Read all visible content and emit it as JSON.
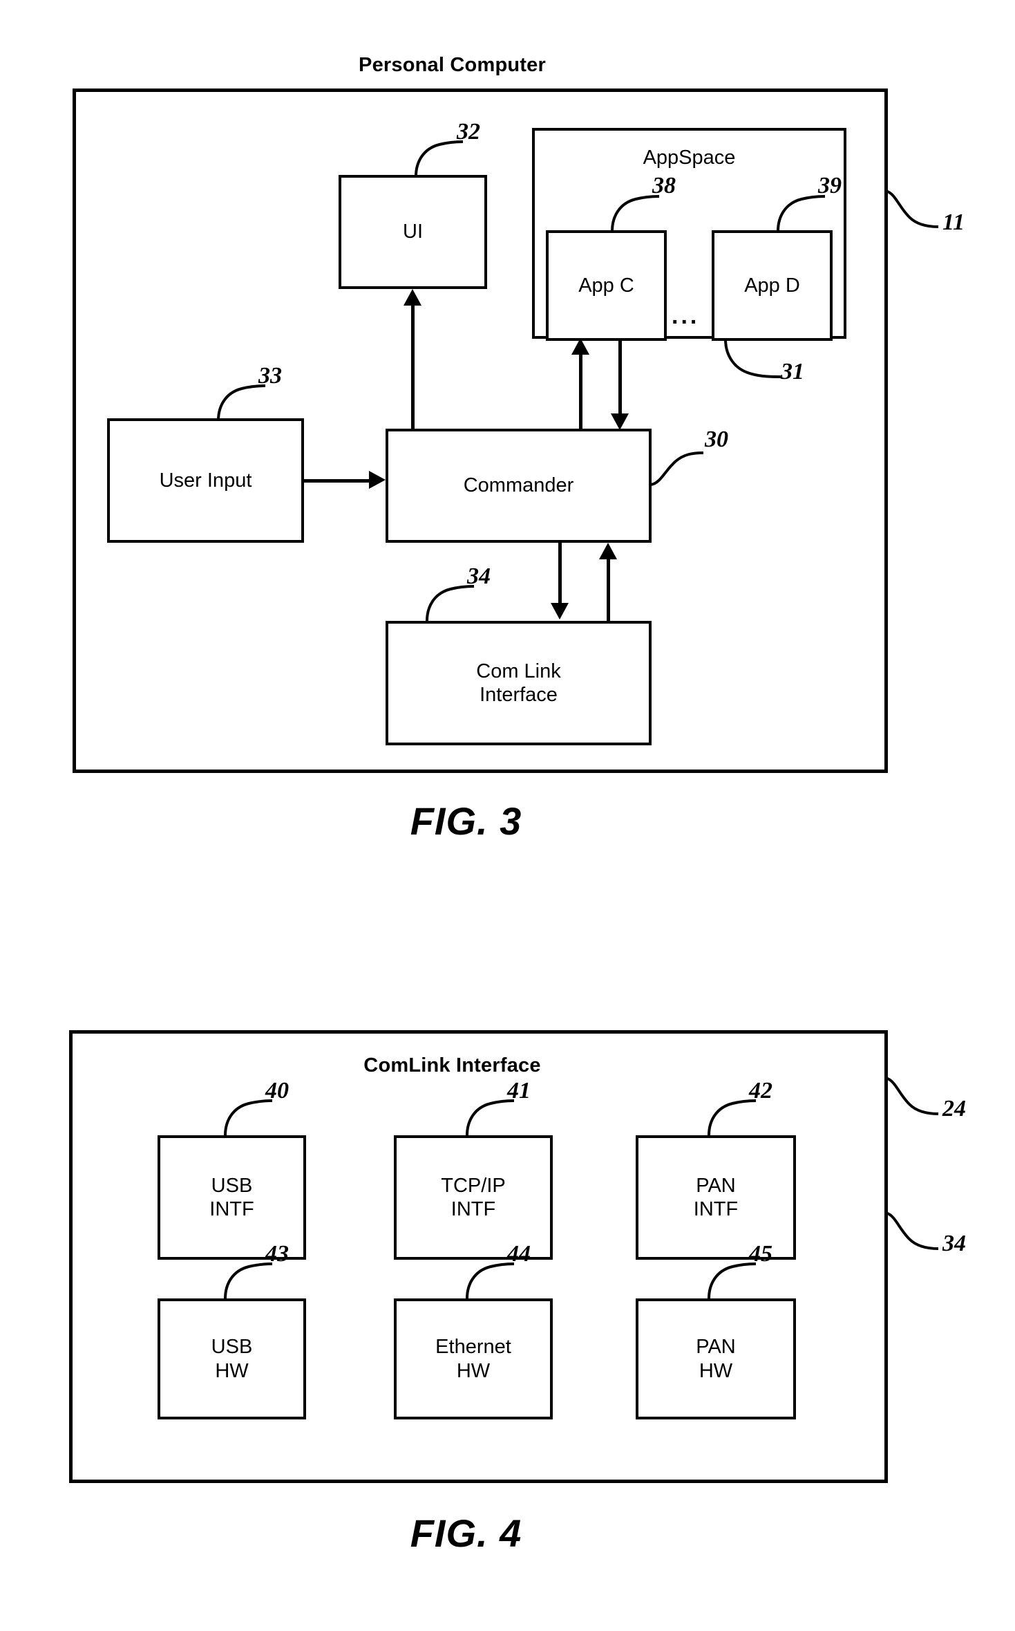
{
  "figures": [
    {
      "id": "fig3",
      "caption": "FIG. 3",
      "frame_title": "Personal Computer",
      "frame_ref": "11",
      "blocks": {
        "ui": {
          "label": "UI",
          "ref": "32"
        },
        "appspace": {
          "label": "AppSpace",
          "ref": "31"
        },
        "app_c": {
          "label": "App C",
          "ref": "38"
        },
        "app_d": {
          "label": "App D",
          "ref": "39"
        },
        "ellipsis": {
          "label": "..."
        },
        "user_input": {
          "label": "User Input",
          "ref": "33"
        },
        "commander": {
          "label": "Commander",
          "ref": "30"
        },
        "com_link": {
          "label": "Com Link\nInterface",
          "ref": "34"
        }
      }
    },
    {
      "id": "fig4",
      "caption": "FIG. 4",
      "frame_title": "ComLink Interface",
      "frame_ref_top": "24",
      "frame_ref_bottom": "34",
      "blocks": {
        "usb_intf": {
          "label": "USB\nINTF",
          "ref": "40"
        },
        "tcp_intf": {
          "label": "TCP/IP\nINTF",
          "ref": "41"
        },
        "pan_intf": {
          "label": "PAN\nINTF",
          "ref": "42"
        },
        "usb_hw": {
          "label": "USB\nHW",
          "ref": "43"
        },
        "eth_hw": {
          "label": "Ethernet\nHW",
          "ref": "44"
        },
        "pan_hw": {
          "label": "PAN\nHW",
          "ref": "45"
        }
      }
    }
  ],
  "colors": {
    "ink": "#000000",
    "paper": "#ffffff"
  }
}
